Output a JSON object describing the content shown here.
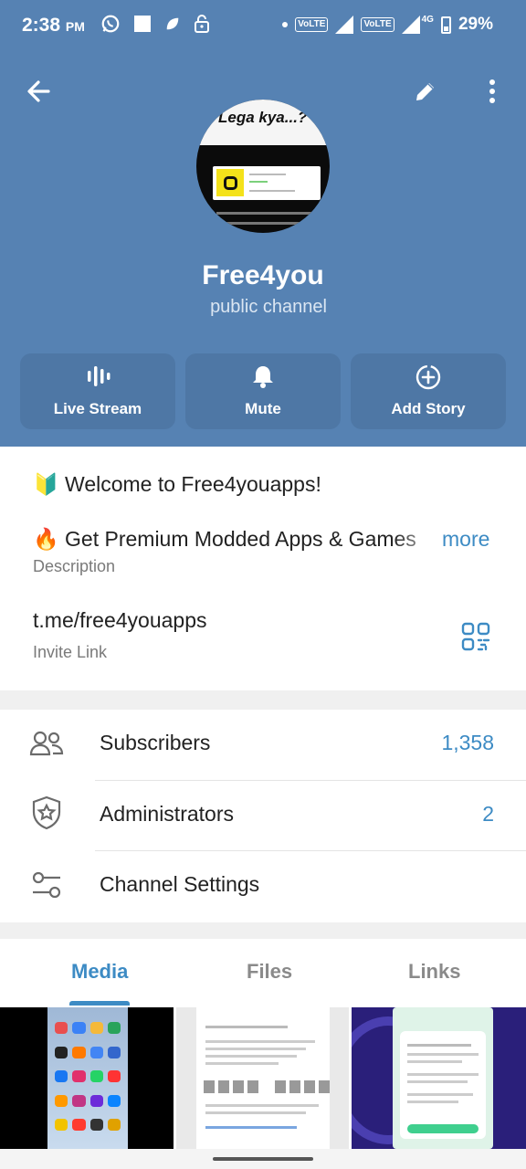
{
  "status_bar": {
    "time": "2:38",
    "ampm": "PM",
    "volte1": "VoLTE",
    "volte2": "VoLTE",
    "network": "4G",
    "battery": "29%"
  },
  "channel": {
    "name": "Free4you",
    "type": "public channel",
    "avatar_text": "Lega kya...?"
  },
  "actions": [
    {
      "label": "Live Stream",
      "icon": "live-stream-icon"
    },
    {
      "label": "Mute",
      "icon": "bell-icon"
    },
    {
      "label": "Add Story",
      "icon": "add-story-icon"
    }
  ],
  "info": {
    "welcome_emoji": "🔰",
    "welcome_text": "Welcome to Free4youapps!",
    "premium_emoji": "🔥",
    "premium_text": "Get Premium Modded Apps & Games",
    "more_label": "more",
    "description_label": "Description",
    "invite_link": "t.me/free4youapps",
    "invite_label": "Invite Link"
  },
  "rows": [
    {
      "label": "Subscribers",
      "value": "1,358",
      "icon": "users-icon"
    },
    {
      "label": "Administrators",
      "value": "2",
      "icon": "shield-star-icon"
    },
    {
      "label": "Channel Settings",
      "value": "",
      "icon": "settings-sliders-icon"
    }
  ],
  "tabs": [
    {
      "label": "Media",
      "active": true
    },
    {
      "label": "Files",
      "active": false
    },
    {
      "label": "Links",
      "active": false
    }
  ],
  "colors": {
    "header": "#5682b3",
    "accent": "#3d8bc4"
  }
}
